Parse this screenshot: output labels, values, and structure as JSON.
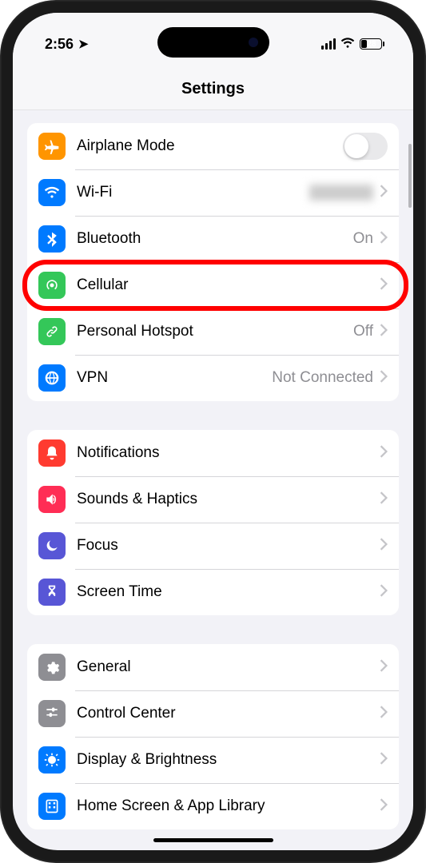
{
  "status": {
    "time": "2:56",
    "battery_percent": "28"
  },
  "header": {
    "title": "Settings"
  },
  "sections": [
    {
      "items": [
        {
          "label": "Airplane Mode"
        },
        {
          "label": "Wi-Fi",
          "value": ""
        },
        {
          "label": "Bluetooth",
          "value": "On"
        },
        {
          "label": "Cellular"
        },
        {
          "label": "Personal Hotspot",
          "value": "Off"
        },
        {
          "label": "VPN",
          "value": "Not Connected"
        }
      ]
    },
    {
      "items": [
        {
          "label": "Notifications"
        },
        {
          "label": "Sounds & Haptics"
        },
        {
          "label": "Focus"
        },
        {
          "label": "Screen Time"
        }
      ]
    },
    {
      "items": [
        {
          "label": "General"
        },
        {
          "label": "Control Center"
        },
        {
          "label": "Display & Brightness"
        },
        {
          "label": "Home Screen & App Library"
        }
      ]
    }
  ]
}
